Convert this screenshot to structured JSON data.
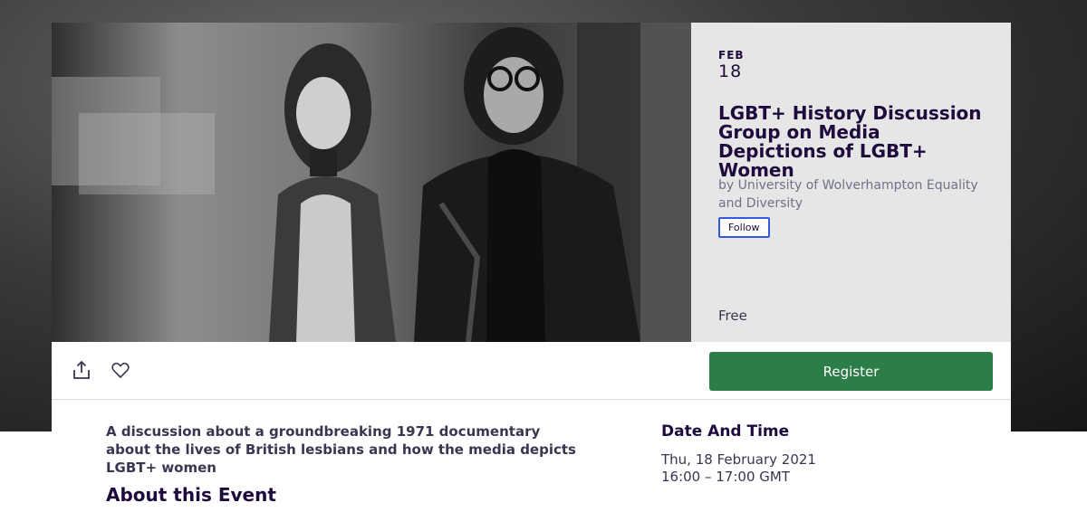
{
  "event": {
    "month": "FEB",
    "day": "18",
    "title": "LGBT+ History Discussion Group on Media Depictions of LGBT+ Women",
    "organizer": "by University of Wolverhampton Equality and Diversity",
    "follow_label": "Follow",
    "price": "Free",
    "register_label": "Register",
    "summary": "A discussion about a groundbreaking 1971 documentary about the lives of British lesbians and how the media depicts LGBT+ women",
    "about_heading_partial": "About this Event"
  },
  "date_time": {
    "heading": "Date And Time",
    "date": "Thu, 18 February 2021",
    "time": "16:00 – 17:00 GMT"
  },
  "icons": {
    "share": "share-icon",
    "like": "heart-icon"
  },
  "colors": {
    "register_bg": "#2d7d49",
    "follow_border": "#3659e3",
    "title_text": "#1e0a3c",
    "panel_bg": "#e6e6e6"
  }
}
